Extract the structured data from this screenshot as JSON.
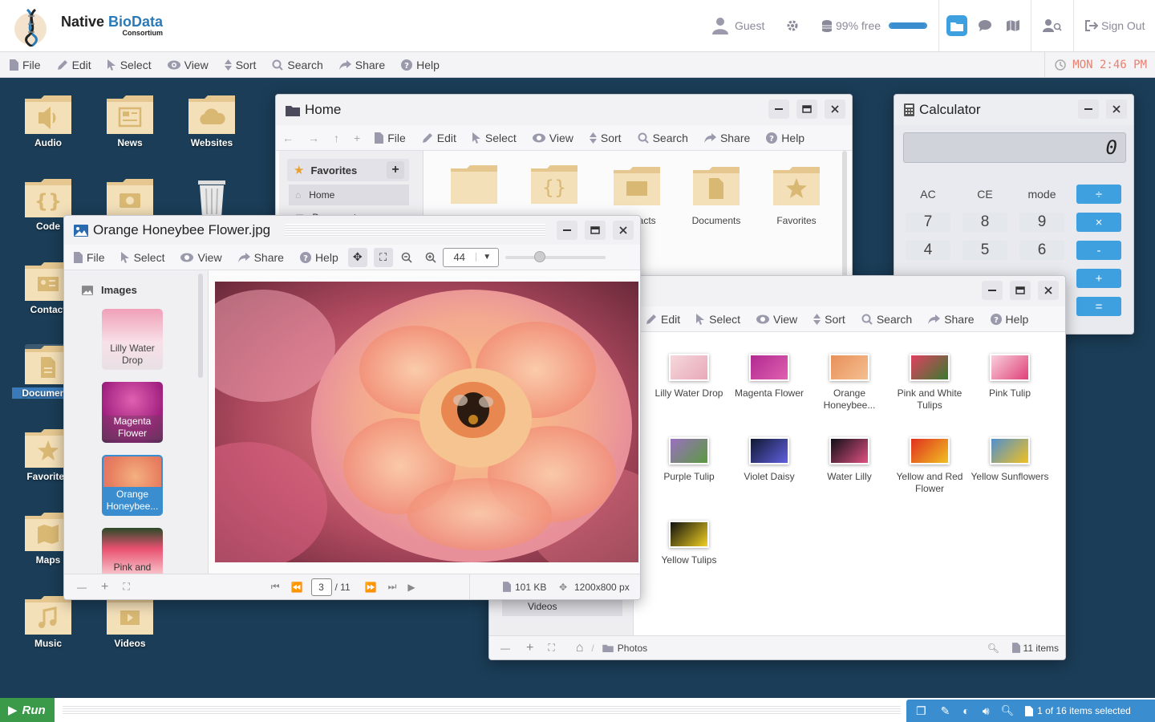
{
  "brand": {
    "name_part1": "Native ",
    "name_part2": "BioData",
    "sub": "Consortium"
  },
  "topbar": {
    "user": "Guest",
    "storage": "99% free",
    "storage_fraction": 0.99,
    "sign_out": "Sign Out"
  },
  "menu": {
    "file": "File",
    "edit": "Edit",
    "select": "Select",
    "view": "View",
    "sort": "Sort",
    "search": "Search",
    "share": "Share",
    "help": "Help"
  },
  "clock": "MON 2:46 PM",
  "desktop_icons": [
    {
      "label": "Audio",
      "icon": "audio-icon"
    },
    {
      "label": "News",
      "icon": "news-icon"
    },
    {
      "label": "Websites",
      "icon": "cloud-icon"
    },
    {
      "label": "Code",
      "icon": "code-icon"
    },
    {
      "label": "Contact",
      "icon": "contact-icon"
    },
    {
      "label": "Documents",
      "icon": "document-icon"
    },
    {
      "label": "Favorites",
      "icon": "star-icon"
    },
    {
      "label": "Maps",
      "icon": "map-icon"
    },
    {
      "label": "Music",
      "icon": "music-icon"
    },
    {
      "label": "Videos",
      "icon": "video-icon"
    }
  ],
  "home_window": {
    "title": "Home",
    "favorites_label": "Favorites",
    "nav": [
      "Home",
      "Documents"
    ],
    "items": [
      "Contacts",
      "Documents",
      "Favorites"
    ]
  },
  "calculator": {
    "title": "Calculator",
    "display": "0",
    "keys": {
      "ac": "AC",
      "ce": "CE",
      "mode": "mode",
      "div": "÷",
      "k7": "7",
      "k8": "8",
      "k9": "9",
      "mul": "×",
      "k4": "4",
      "k5": "5",
      "k6": "6",
      "sub": "-",
      "add": "+",
      "eq": "="
    }
  },
  "photos_window": {
    "path": "Photos",
    "count": "11 items",
    "items": [
      {
        "label": "Lilly Water Drop",
        "colors": [
          "#f5d8dc",
          "#e8a8b8"
        ]
      },
      {
        "label": "Magenta Flower",
        "colors": [
          "#b02a90",
          "#e060b0"
        ]
      },
      {
        "label": "Orange Honeybee...",
        "colors": [
          "#e8905a",
          "#f4c090"
        ]
      },
      {
        "label": "Pink and White Tulips",
        "colors": [
          "#e04060",
          "#3a7a30"
        ]
      },
      {
        "label": "Pink Tulip",
        "colors": [
          "#f8d0dc",
          "#e04078"
        ]
      },
      {
        "label": "Purple Tulip",
        "colors": [
          "#9a70c0",
          "#5a9a40"
        ]
      },
      {
        "label": "Violet Daisy",
        "colors": [
          "#101830",
          "#6060e0"
        ]
      },
      {
        "label": "Water Lilly",
        "colors": [
          "#101018",
          "#e05080"
        ]
      },
      {
        "label": "Yellow and Red Flower",
        "colors": [
          "#e03020",
          "#f0c020"
        ]
      },
      {
        "label": "Yellow Sunflowers",
        "colors": [
          "#5090d0",
          "#f0c020"
        ]
      },
      {
        "label": "Yellow Tulips",
        "colors": [
          "#101010",
          "#f0d020"
        ]
      }
    ],
    "left_stub": "Videos"
  },
  "image_viewer": {
    "title": "Orange Honeybee Flower.jpg",
    "zoom": "44",
    "zoom_fraction": 0.35,
    "side_title": "Images",
    "side_items": [
      "Lilly Water Drop",
      "Magenta Flower",
      "Orange Honeybee...",
      "Pink and"
    ],
    "page": "3",
    "total": "/ 11",
    "size": "101 KB",
    "dims": "1200x800 px"
  },
  "taskbar": {
    "run": "Run",
    "status": "1 of 16 items selected"
  }
}
